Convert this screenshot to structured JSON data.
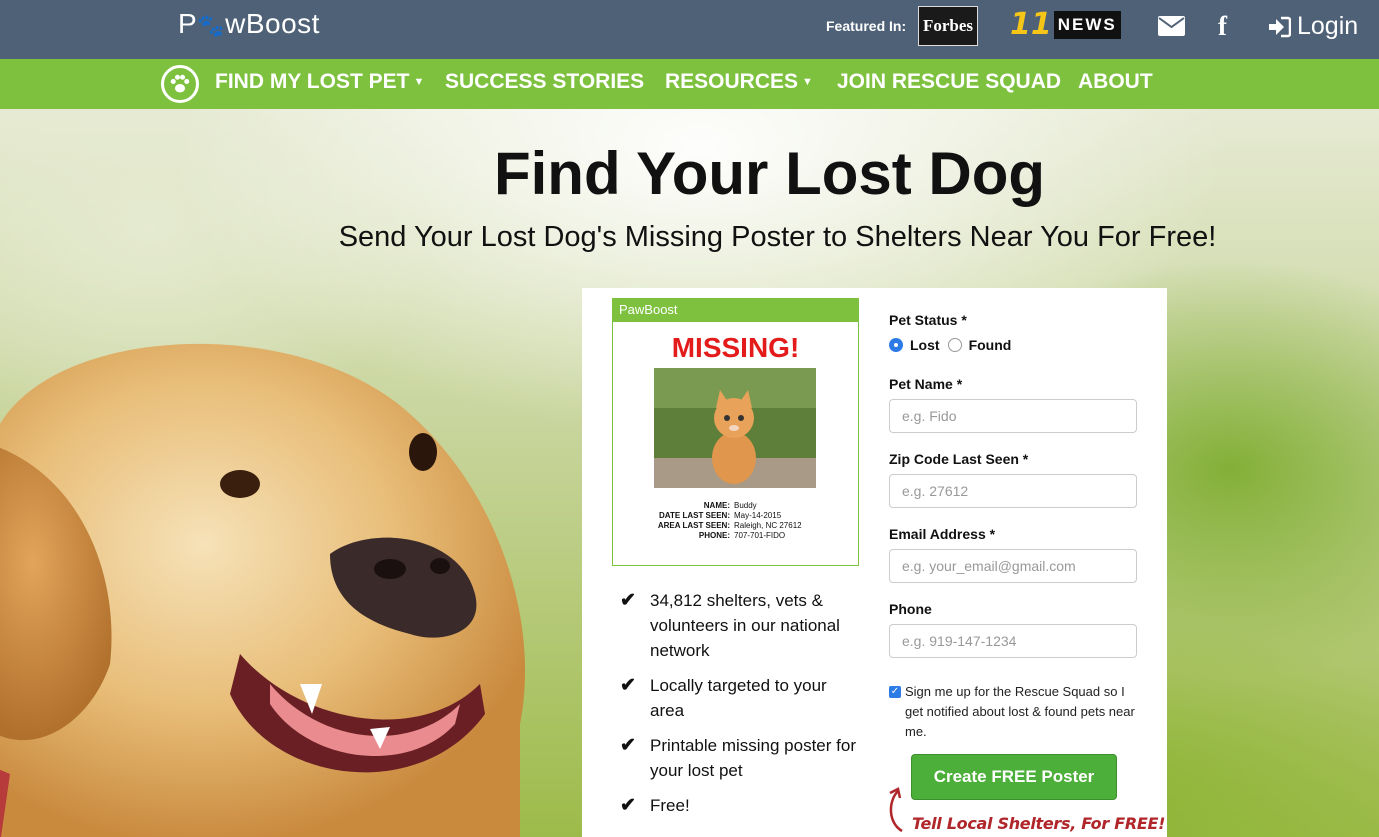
{
  "brand": {
    "logo_text_pre": "P",
    "logo_text_post": "wBoost"
  },
  "topbar": {
    "featured_label": "Featured In:",
    "forbes_logo": "Forbes",
    "abc_number": "11",
    "abc_news": "NEWS",
    "login_label": "Login"
  },
  "nav": {
    "items": [
      {
        "label": "FIND MY LOST PET",
        "has_dropdown": true
      },
      {
        "label": "SUCCESS STORIES",
        "has_dropdown": false
      },
      {
        "label": "RESOURCES",
        "has_dropdown": true
      },
      {
        "label": "JOIN RESCUE SQUAD",
        "has_dropdown": false
      },
      {
        "label": "ABOUT",
        "has_dropdown": false
      }
    ]
  },
  "hero": {
    "title": "Find Your Lost Dog",
    "subtitle": "Send Your Lost Dog's Missing Poster to Shelters Near You For Free!"
  },
  "poster": {
    "brand": "PawBoost",
    "title": "MISSING!",
    "info": [
      {
        "key": "NAME:",
        "value": "Buddy"
      },
      {
        "key": "DATE LAST SEEN:",
        "value": "May-14-2015"
      },
      {
        "key": "AREA LAST SEEN:",
        "value": "Raleigh, NC 27612"
      },
      {
        "key": "PHONE:",
        "value": "707-701-FIDO"
      }
    ]
  },
  "benefits": [
    "34,812 shelters, vets & volunteers in our national network",
    "Locally targeted to your area",
    "Printable missing poster for your lost pet",
    "Free!"
  ],
  "form": {
    "status_label": "Pet Status *",
    "status_options": [
      "Lost",
      "Found"
    ],
    "status_selected": "Lost",
    "pet_name_label": "Pet Name *",
    "pet_name_placeholder": "e.g. Fido",
    "zip_label": "Zip Code Last Seen *",
    "zip_placeholder": "e.g. 27612",
    "email_label": "Email Address *",
    "email_placeholder": "e.g. your_email@gmail.com",
    "phone_label": "Phone",
    "phone_placeholder": "e.g. 919-147-1234",
    "signup_text": "Sign me up for the Rescue Squad so I get notified about lost & found pets near me.",
    "signup_checked": true,
    "submit_label": "Create FREE Poster",
    "tagline": "Tell Local Shelters, For FREE!"
  },
  "colors": {
    "topbar": "#4f6177",
    "nav": "#7dc13f",
    "cta": "#4caf39",
    "missing": "#e41b1b"
  }
}
